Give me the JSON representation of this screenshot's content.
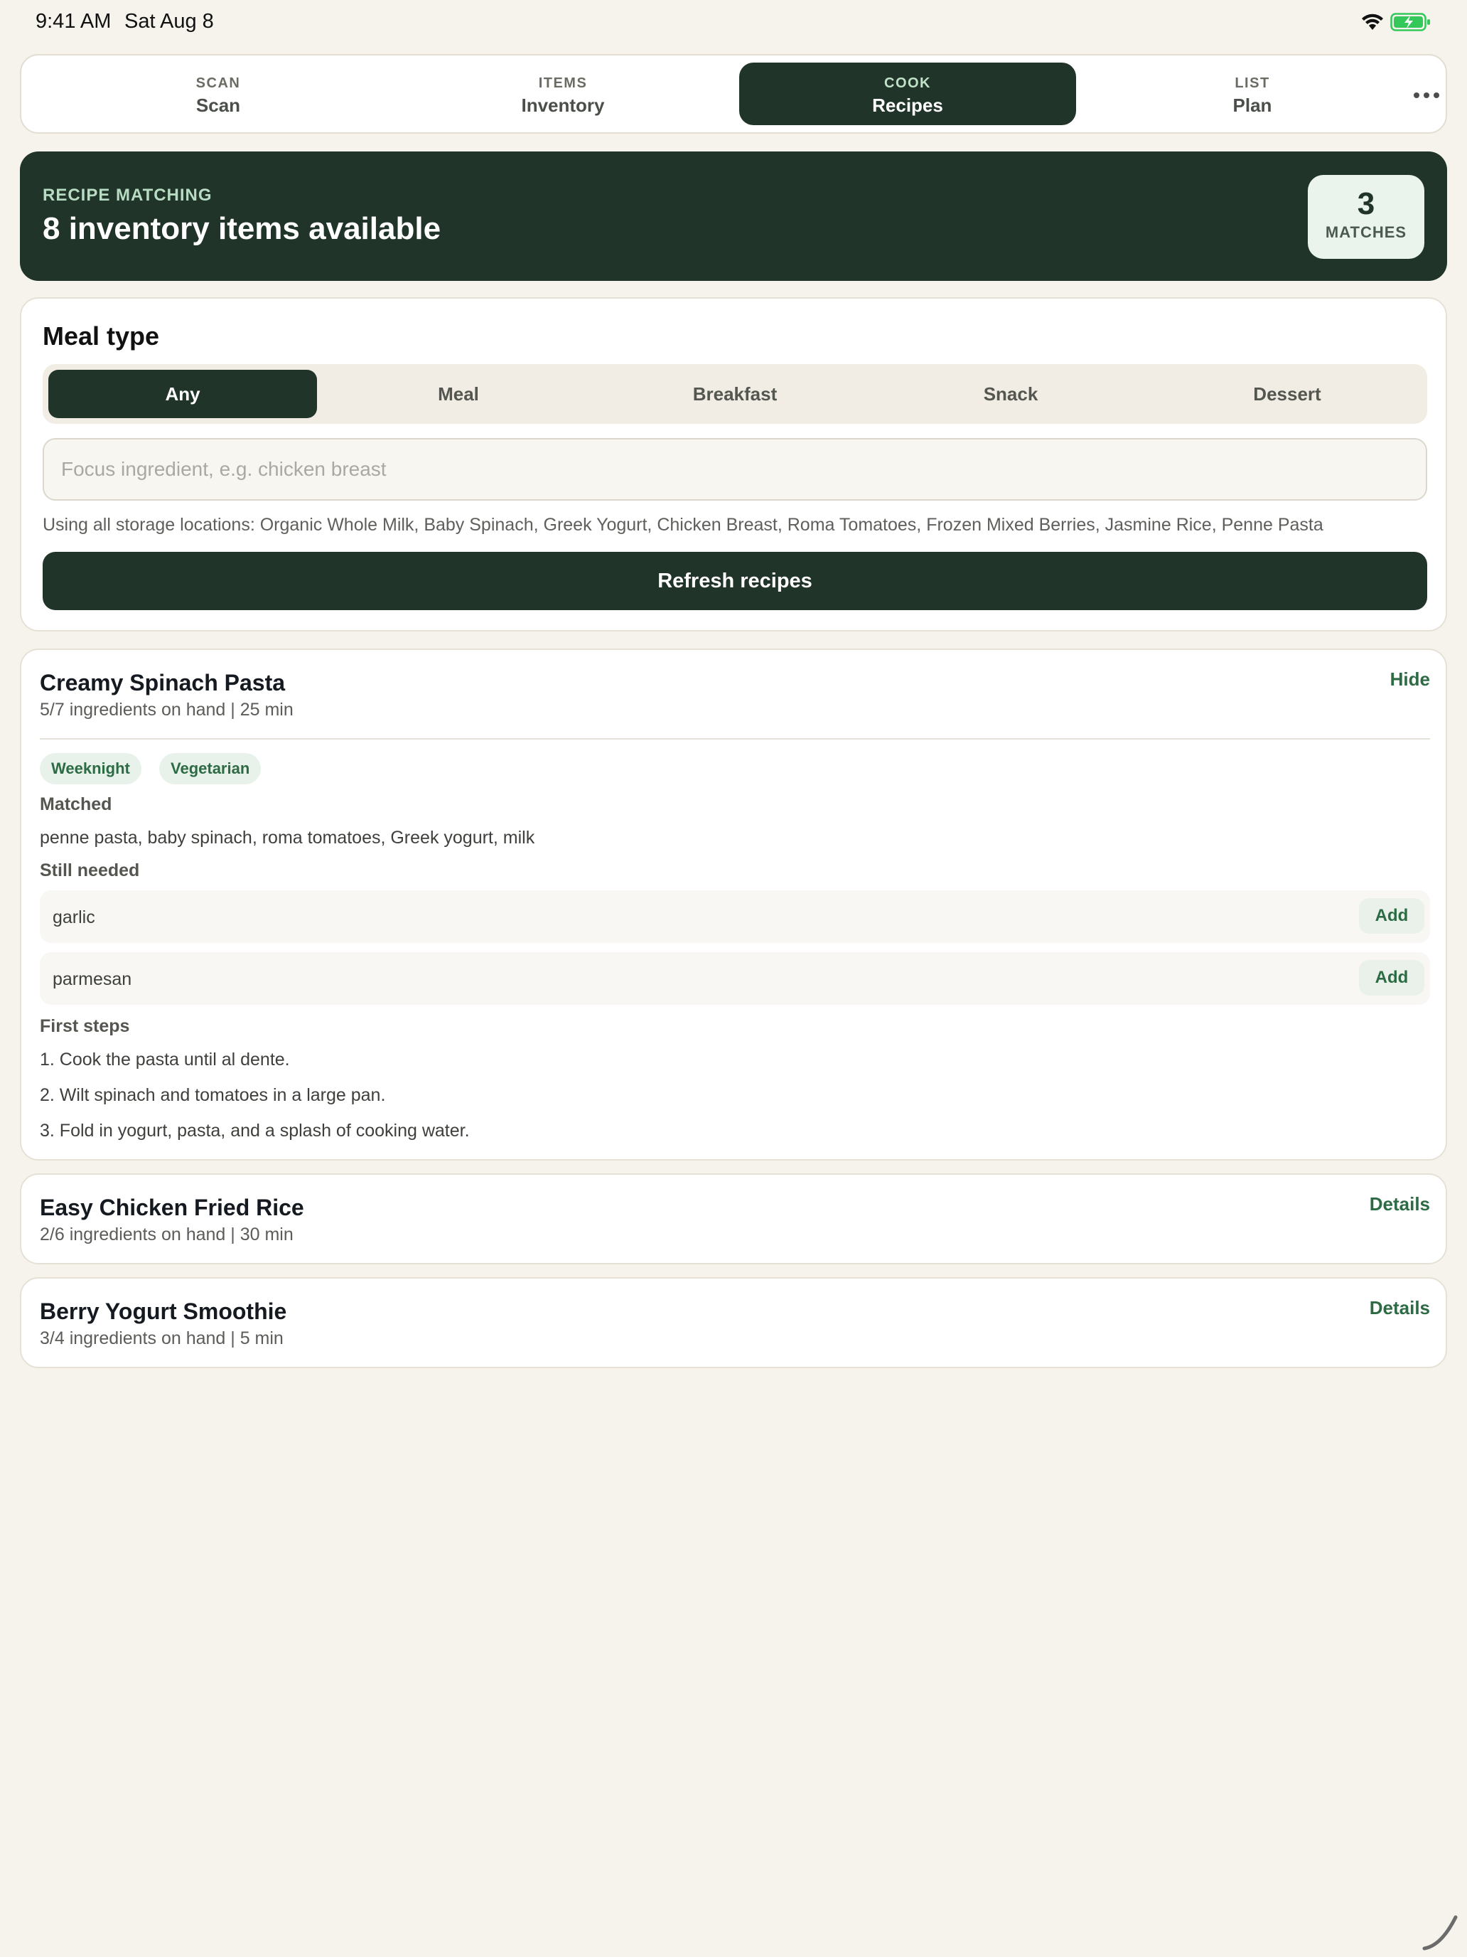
{
  "status_bar": {
    "time": "9:41 AM",
    "date": "Sat Aug 8"
  },
  "tabs": [
    {
      "caption": "SCAN",
      "label": "Scan",
      "active": false
    },
    {
      "caption": "ITEMS",
      "label": "Inventory",
      "active": false
    },
    {
      "caption": "COOK",
      "label": "Recipes",
      "active": true
    },
    {
      "caption": "LIST",
      "label": "Plan",
      "active": false
    }
  ],
  "hero": {
    "kicker": "RECIPE MATCHING",
    "headline": "8 inventory items available",
    "matches_count": "3",
    "matches_label": "MATCHES"
  },
  "meal_type": {
    "title": "Meal type",
    "options": [
      "Any",
      "Meal",
      "Breakfast",
      "Snack",
      "Dessert"
    ],
    "selected": "Any",
    "focus_placeholder": "Focus ingredient, e.g. chicken breast",
    "focus_value": "",
    "using_text": "Using all storage locations: Organic Whole Milk, Baby Spinach, Greek Yogurt, Chicken Breast, Roma Tomatoes, Frozen Mixed Berries, Jasmine Rice, Penne Pasta",
    "refresh_label": "Refresh recipes"
  },
  "recipes": [
    {
      "title": "Creamy Spinach Pasta",
      "meta": "5/7 ingredients on hand | 25 min",
      "action": "Hide",
      "tags": [
        "Weeknight",
        "Vegetarian"
      ],
      "matched_label": "Matched",
      "matched": "penne pasta, baby spinach, roma tomatoes, Greek yogurt, milk",
      "needed_label": "Still needed",
      "needed": [
        {
          "name": "garlic",
          "action": "Add"
        },
        {
          "name": "parmesan",
          "action": "Add"
        }
      ],
      "steps_label": "First steps",
      "steps": [
        "1. Cook the pasta until al dente.",
        "2. Wilt spinach and tomatoes in a large pan.",
        "3. Fold in yogurt, pasta, and a splash of cooking water."
      ]
    },
    {
      "title": "Easy Chicken Fried Rice",
      "meta": "2/6 ingredients on hand | 30 min",
      "action": "Details"
    },
    {
      "title": "Berry Yogurt Smoothie",
      "meta": "3/4 ingredients on hand | 5 min",
      "action": "Details"
    }
  ],
  "colors": {
    "background": "#f6f3ec",
    "primary_dark": "#213429",
    "accent_green": "#2d6b45",
    "chip_bg": "#e8f2ea"
  },
  "icons": [
    "wifi-icon",
    "battery-charging-icon",
    "more-horizontal-icon",
    "home-indicator-icon"
  ]
}
